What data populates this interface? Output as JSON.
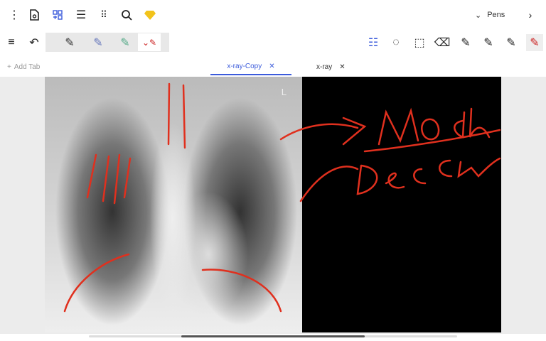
{
  "toolbar": {
    "icons": [
      "more-vertical-icon",
      "document-settings-icon",
      "layout-grid-icon",
      "list-icon",
      "apps-grid-icon",
      "search-icon",
      "premium-diamond-icon"
    ],
    "pens_label": "Pens"
  },
  "tools": [
    "menu-icon",
    "undo-icon",
    "pen-black",
    "pen-blue",
    "pen-green",
    "pen-red",
    "adjust-icon",
    "lasso-icon",
    "select-icon",
    "eraser-icon",
    "pen-icon"
  ],
  "tabs": {
    "add_label": "Add Tab",
    "items": [
      {
        "label": "x-ray-Copy",
        "active": true
      },
      {
        "label": "x-ray",
        "active": false
      }
    ]
  },
  "image": {
    "marker": "L"
  },
  "colors": {
    "accent": "#3b5bdb",
    "ink": "#e0301e",
    "premium": "#f2c31b"
  }
}
